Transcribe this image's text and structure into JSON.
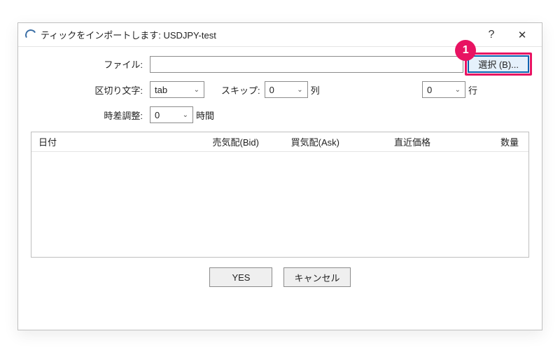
{
  "title": "ティックをインポートします: USDJPY-test",
  "annotation": {
    "number": "1"
  },
  "labels": {
    "file": "ファイル:",
    "delimiter": "区切り文字:",
    "skip": "スキップ:",
    "columns_suffix": "列",
    "rows_suffix": "行",
    "time_adjust": "時差調整:",
    "hours_suffix": "時間"
  },
  "fields": {
    "file_value": "",
    "delimiter_value": "tab",
    "skip_cols": "0",
    "skip_rows": "0",
    "time_offset": "0"
  },
  "buttons": {
    "browse": "選択 (B)...",
    "yes": "YES",
    "cancel": "キャンセル"
  },
  "columns": {
    "date": "日付",
    "bid": "売気配(Bid)",
    "ask": "買気配(Ask)",
    "last": "直近価格",
    "volume": "数量"
  },
  "titlebar": {
    "help_glyph": "?",
    "close_glyph": "✕"
  },
  "caret_glyph": "⌄"
}
